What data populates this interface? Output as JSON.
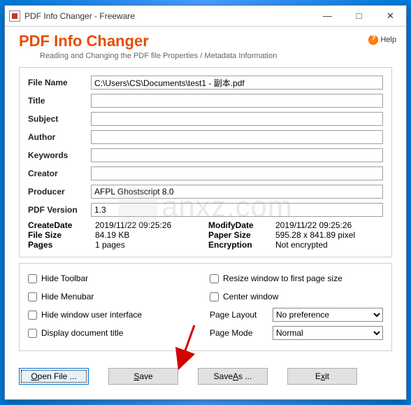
{
  "window": {
    "title": "PDF Info Changer - Freeware"
  },
  "header": {
    "app_title": "PDF Info Changer",
    "subtitle": "Reading and Changing the PDF file Properties / Metadata Information",
    "help_label": "Help"
  },
  "fields": {
    "file_name_label": "File Name",
    "file_name": "C:\\Users\\CS\\Documents\\test1 - 副本.pdf",
    "title_label": "Title",
    "title": "",
    "subject_label": "Subject",
    "subject": "",
    "author_label": "Author",
    "author": "",
    "keywords_label": "Keywords",
    "keywords": "",
    "creator_label": "Creator",
    "creator": "",
    "producer_label": "Producer",
    "producer": "AFPL Ghostscript 8.0",
    "pdfversion_label": "PDF Version",
    "pdfversion": "1.3"
  },
  "info": {
    "createdate_label": "CreateDate",
    "createdate": "2019/11/22 09:25:26",
    "modifydate_label": "ModifyDate",
    "modifydate": "2019/11/22 09:25:26",
    "filesize_label": "File Size",
    "filesize": "84.19 KB",
    "papersize_label": "Paper Size",
    "papersize": "595.28 x 841.89 pixel",
    "pages_label": "Pages",
    "pages": "1 pages",
    "encryption_label": "Encryption",
    "encryption": "Not encrypted"
  },
  "options": {
    "hide_toolbar": "Hide Toolbar",
    "hide_menubar": "Hide Menubar",
    "hide_ui": "Hide window user interface",
    "display_title": "Display document title",
    "resize_window": "Resize window to first page size",
    "center_window": "Center window",
    "page_layout_label": "Page Layout",
    "page_layout": "No preference",
    "page_mode_label": "Page Mode",
    "page_mode": "Normal"
  },
  "buttons": {
    "open_pre": "O",
    "open_post": "pen File ...",
    "save_pre": "S",
    "save_post": "ave",
    "saveas_pre": "Save ",
    "saveas_mid": "A",
    "saveas_post": "s ...",
    "exit_pre": "E",
    "exit_mid": "x",
    "exit_post": "it"
  },
  "watermark": {
    "text": "anxz.com"
  }
}
